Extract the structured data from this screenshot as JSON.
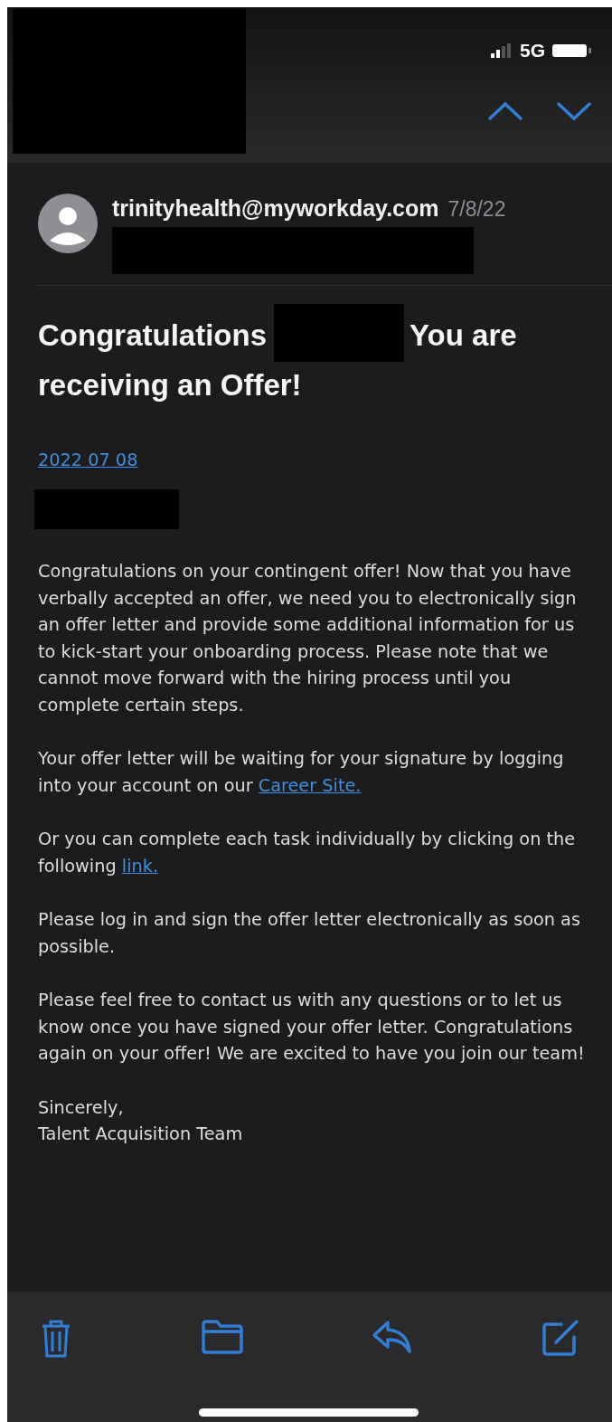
{
  "status_bar": {
    "network": "5G"
  },
  "sender": {
    "email": "trinityhealth@myworkday.com",
    "date": "7/8/22"
  },
  "subject_parts": [
    "Congratulations",
    "You are",
    "receiving an Offer!"
  ],
  "date_link": "2022 07 08",
  "paragraphs": [
    {
      "parts": [
        {
          "kind": "text",
          "text": "Congratulations on your contingent offer! Now that you have verbally accepted an offer, we need you to electronically sign an offer letter and provide some additional information for us to kick-start your onboarding process. Please note that we cannot move forward with the hiring process until you complete certain steps."
        }
      ]
    },
    {
      "parts": [
        {
          "kind": "text",
          "text": "Your offer letter will be waiting for your signature by logging into your account on our "
        },
        {
          "kind": "link",
          "text": "Career Site."
        }
      ]
    },
    {
      "parts": [
        {
          "kind": "text",
          "text": "Or you can complete each task individually by clicking on the following "
        },
        {
          "kind": "link",
          "text": "link."
        }
      ]
    },
    {
      "parts": [
        {
          "kind": "text",
          "text": "Please log in and sign the offer letter electronically as soon as possible."
        }
      ]
    },
    {
      "parts": [
        {
          "kind": "text",
          "text": "Please feel free to contact us with any questions or to let us know once you have signed your offer letter. Congratulations again on your offer! We are excited to have you join our team!"
        }
      ]
    }
  ],
  "signature": [
    "Sincerely,",
    "Talent Acquisition Team"
  ]
}
